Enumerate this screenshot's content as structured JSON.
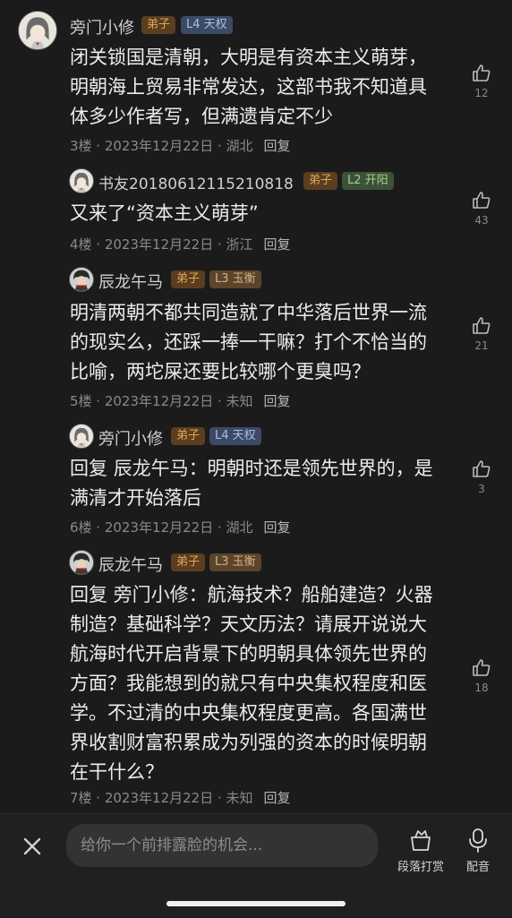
{
  "comments": [
    {
      "user": "旁门小修",
      "badge": "弟子",
      "level": "L4 天权",
      "lines": [
        "闭关锁国是清朝，大明是有资本主义萌芽，",
        "明朝海上贸易非常发达，这部书我不知道具",
        "体多少作者写，但满遗肯定不少"
      ],
      "meta": "3楼 · 2023年12月22日 · 湖北",
      "reply_label": "回复",
      "likes": "12",
      "avatar_icon": "anime-girl-avatar"
    },
    {
      "user": "书友20180612115210818",
      "badge": "弟子",
      "level": "L2 开阳",
      "lines": [
        "又来了“资本主义萌芽”"
      ],
      "meta": "4楼 · 2023年12月22日 · 浙江",
      "reply_label": "回复",
      "likes": "43",
      "avatar_icon": "anime-girl-avatar"
    },
    {
      "user": "辰龙午马",
      "badge": "弟子",
      "level": "L3 玉衡",
      "lines": [
        "明清两朝不都共同造就了中华落后世界一流",
        "的现实么，还踩一捧一干嘛？打个不恰当的",
        "比喻，两坨屎还要比较哪个更臭吗？"
      ],
      "meta": "5楼 · 2023年12月22日 · 未知",
      "reply_label": "回复",
      "likes": "21",
      "avatar_icon": "warrior-avatar"
    },
    {
      "user": "旁门小修",
      "badge": "弟子",
      "level": "L4 天权",
      "reply_prefix": "回复",
      "reply_to": "辰龙午马",
      "lines": [
        "：明朝时还是领先世界的，是",
        "满清才开始落后"
      ],
      "meta": "6楼 · 2023年12月22日 · 湖北",
      "reply_label": "回复",
      "likes": "3",
      "avatar_icon": "anime-girl-avatar"
    },
    {
      "user": "辰龙午马",
      "badge": "弟子",
      "level": "L3 玉衡",
      "reply_prefix": "回复",
      "reply_to": "旁门小修",
      "lines": [
        "：航海技术？船舶建造？火器",
        "制造？基础科学？天文历法？请展开说说大",
        "航海时代开启背景下的明朝具体领先世界的",
        "方面？我能想到的就只有中央集权程度和医",
        "学。不过清的中央集权程度更高。各国满世",
        "界收割财富积累成为列强的资本的时候明朝",
        "在干什么？"
      ],
      "meta": "7楼 · 2023年12月22日 · 未知",
      "reply_label": "回复",
      "likes": "18",
      "avatar_icon": "warrior-avatar"
    }
  ],
  "bottom_bar": {
    "close_icon": "close-icon",
    "input_placeholder": "给你一个前排露脸的机会...",
    "tip_label": "段落打赏",
    "voice_label": "配音"
  },
  "colors": {
    "background": "#1b1b1b",
    "badge_disciple": "#e0a659",
    "meta": "#8a8a8a"
  }
}
